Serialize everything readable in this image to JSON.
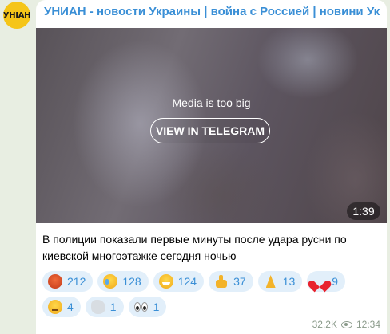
{
  "channel": {
    "name": "УНИАН - новости Украины | война с Россией | новини Украї...",
    "avatar_text": "УНІАН"
  },
  "media": {
    "note": "Media is too big",
    "button_label": "VIEW IN TELEGRAM",
    "duration": "1:39"
  },
  "message": {
    "text": "В полиции показали первые минуты после удара русни по киевской многоэтажке сегодня ночью"
  },
  "reactions": [
    {
      "icon": "angry-face-emoji",
      "count": "212"
    },
    {
      "icon": "crying-face-emoji",
      "count": "128"
    },
    {
      "icon": "grinning-face-emoji",
      "count": "124"
    },
    {
      "icon": "thumbs-up-emoji",
      "count": "37"
    },
    {
      "icon": "folded-hands-emoji",
      "count": "13"
    },
    {
      "icon": "red-heart-emoji",
      "count": "9"
    },
    {
      "icon": "neutral-face-emoji",
      "count": "4"
    },
    {
      "icon": "dove-emoji",
      "count": "1"
    },
    {
      "icon": "eyes-emoji",
      "count": "1"
    }
  ],
  "footer": {
    "views": "32.2K",
    "time": "12:34"
  },
  "colors": {
    "accent": "#3a8fd6",
    "background": "#e8eee2",
    "reaction_bg": "#e2effa",
    "avatar": "#f5c518"
  }
}
